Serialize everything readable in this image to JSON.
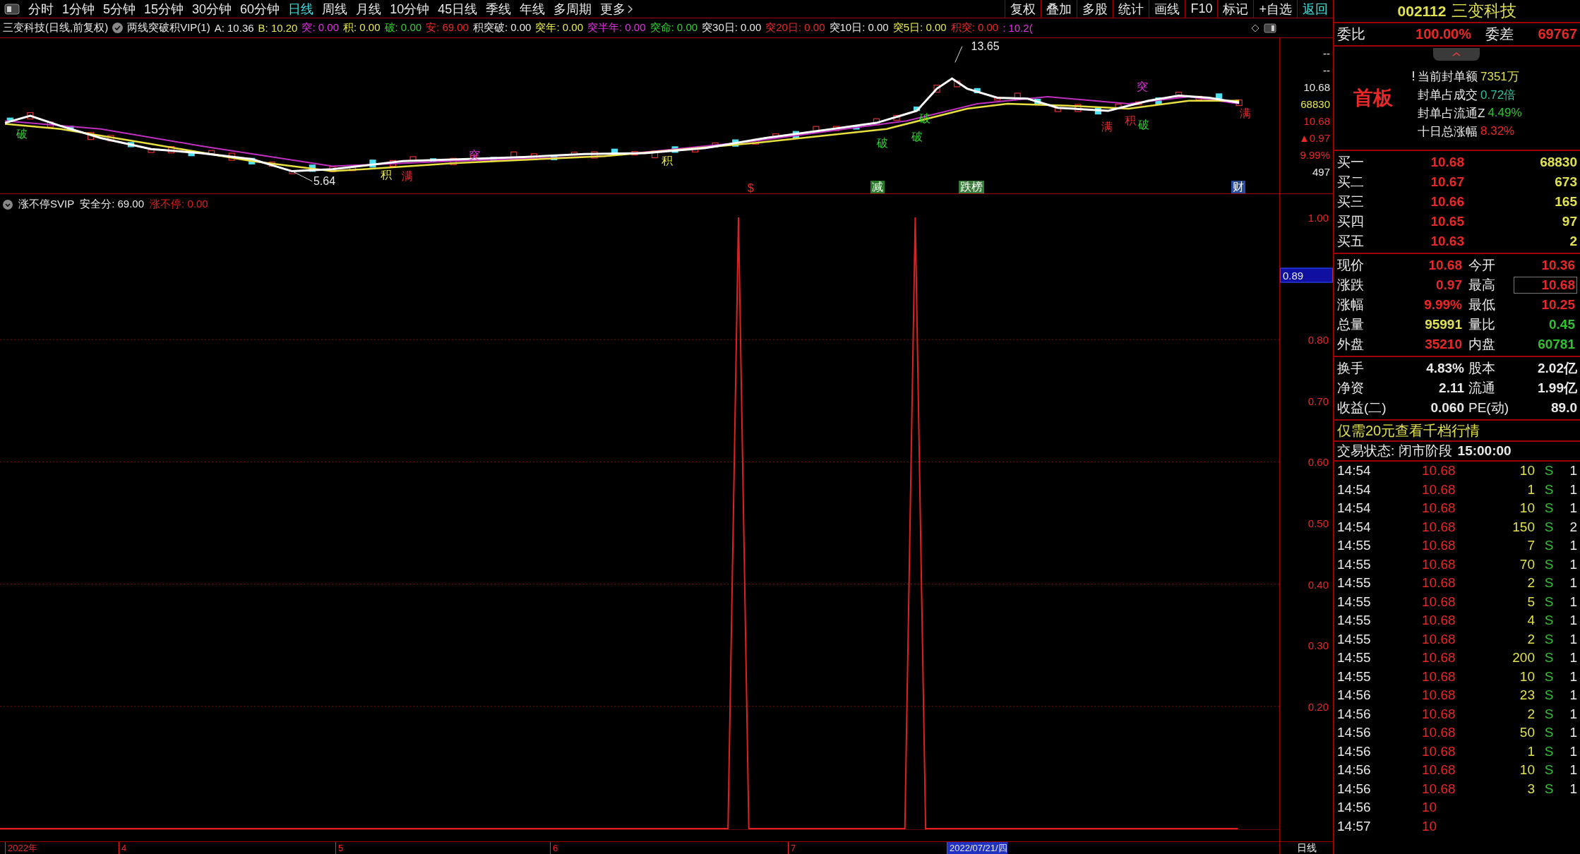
{
  "toolbar": {
    "periods": [
      {
        "label": "分时",
        "selected": false
      },
      {
        "label": "1分钟",
        "selected": false
      },
      {
        "label": "5分钟",
        "selected": false
      },
      {
        "label": "15分钟",
        "selected": false
      },
      {
        "label": "30分钟",
        "selected": false
      },
      {
        "label": "60分钟",
        "selected": false
      },
      {
        "label": "日线",
        "selected": true
      },
      {
        "label": "周线",
        "selected": false
      },
      {
        "label": "月线",
        "selected": false
      },
      {
        "label": "10分钟",
        "selected": false
      },
      {
        "label": "45日线",
        "selected": false
      },
      {
        "label": "季线",
        "selected": false
      },
      {
        "label": "年线",
        "selected": false
      },
      {
        "label": "多周期",
        "selected": false
      }
    ],
    "more": "更多",
    "actions": [
      {
        "label": "复权",
        "selected": false
      },
      {
        "label": "叠加",
        "selected": false
      },
      {
        "label": "多股",
        "selected": false
      },
      {
        "label": "统计",
        "selected": false
      },
      {
        "label": "画线",
        "selected": false
      },
      {
        "label": "F10",
        "selected": false
      },
      {
        "label": "标记",
        "selected": false
      },
      {
        "label": "+自选",
        "selected": false
      },
      {
        "label": "返回",
        "selected": true
      }
    ]
  },
  "chart_header": {
    "title": "三变科技(日线,前复权)",
    "indicator": "两线突破积VIP(1)",
    "items": [
      {
        "text": "A: 10.36",
        "color": "#e8e8e8"
      },
      {
        "text": "B: 10.20",
        "color": "#e8e850"
      },
      {
        "text": "突: 0.00",
        "color": "#e030e0"
      },
      {
        "text": "积: 0.00",
        "color": "#e8e850"
      },
      {
        "text": "破: 0.00",
        "color": "#30d030"
      },
      {
        "text": "安: 69.00",
        "color": "#e82828"
      },
      {
        "text": "积突破: 0.00",
        "color": "#e8e8e8"
      },
      {
        "text": "突年: 0.00",
        "color": "#e8e850"
      },
      {
        "text": "突半年: 0.00",
        "color": "#e030e0"
      },
      {
        "text": "突命: 0.00",
        "color": "#30d030"
      },
      {
        "text": "突30日: 0.00",
        "color": "#e8e8e8"
      },
      {
        "text": "突20日: 0.00",
        "color": "#e82828"
      },
      {
        "text": "突10日: 0.00",
        "color": "#e8e8e8"
      },
      {
        "text": "突5日: 0.00",
        "color": "#e8e850"
      },
      {
        "text": "积突: 0.00",
        "color": "#e82828"
      },
      {
        "text": ": 10.2(",
        "color": "#e030e0"
      }
    ]
  },
  "price_chart": {
    "markers": [
      {
        "label": "破",
        "kind": "signal",
        "color": "#30d030"
      },
      {
        "label": "5.64",
        "kind": "price",
        "color": "#e8e8e8"
      },
      {
        "label": "积",
        "kind": "signal",
        "color": "#e8e850"
      },
      {
        "label": "满",
        "kind": "signal",
        "color": "#e82828"
      },
      {
        "label": "突",
        "kind": "signal",
        "color": "#e030e0"
      },
      {
        "label": "积",
        "kind": "signal",
        "color": "#e8e850"
      },
      {
        "label": "破",
        "kind": "signal",
        "color": "#30d030"
      },
      {
        "label": "破",
        "kind": "signal",
        "color": "#30d030"
      },
      {
        "label": "破",
        "kind": "signal",
        "color": "#30d030"
      },
      {
        "label": "13.65",
        "kind": "price",
        "color": "#e8e8e8"
      },
      {
        "label": "突",
        "kind": "signal",
        "color": "#e030e0"
      },
      {
        "label": "满",
        "kind": "signal",
        "color": "#e82828"
      },
      {
        "label": "积",
        "kind": "signal",
        "color": "#e82828"
      },
      {
        "label": "破",
        "kind": "signal",
        "color": "#30d030"
      },
      {
        "label": "满",
        "kind": "signal",
        "color": "#e82828"
      },
      {
        "label": "$",
        "kind": "signal",
        "color": "#e82828"
      },
      {
        "label": "减",
        "kind": "tag",
        "color": "#2a7a2a"
      },
      {
        "label": "跌榜",
        "kind": "tag",
        "color": "#3a7a3a"
      },
      {
        "label": "财",
        "kind": "tag",
        "color": "#2a4a9a"
      }
    ],
    "axis_labels": [
      {
        "text": "--",
        "color": "#e8e8e8"
      },
      {
        "text": "--",
        "color": "#e8e8e8"
      },
      {
        "text": "10.68",
        "color": "#e8e8e8"
      },
      {
        "text": "68830",
        "color": "#e8e850"
      },
      {
        "text": "10.68",
        "color": "#e82828"
      },
      {
        "text": "▲0.97",
        "color": "#e82828"
      },
      {
        "text": "9.99%",
        "color": "#e82828"
      },
      {
        "text": "497",
        "color": "#e8e8e8"
      }
    ]
  },
  "indicator": {
    "title": "涨不停SVIP",
    "items": [
      {
        "text": "安全分: 69.00"
      }
    ],
    "legend_value": ": 0.00",
    "cursor_value": "0.89",
    "chart_data": {
      "type": "line",
      "grid": true,
      "ylim": [
        0,
        1
      ],
      "yticks": [
        {
          "value": 1,
          "label": "1.00"
        },
        {
          "value": 0.8,
          "label": "0.80"
        },
        {
          "value": 0.7,
          "label": "0.70"
        },
        {
          "value": 0.6,
          "label": "0.60"
        },
        {
          "value": 0.5,
          "label": "0.50"
        },
        {
          "value": 0.4,
          "label": "0.40"
        },
        {
          "value": 0.3,
          "label": "0.30"
        },
        {
          "value": 0.2,
          "label": "0.20"
        }
      ],
      "series": [
        {
          "name": "涨不停",
          "color": "#e02020",
          "values": [
            0,
            0,
            0,
            0,
            0,
            0,
            0,
            0,
            0,
            0,
            0,
            0,
            0,
            0,
            0,
            0,
            0,
            0,
            0,
            0,
            0,
            0,
            0,
            0,
            0,
            0,
            0,
            0,
            0,
            0,
            0,
            0,
            0,
            0,
            0,
            0,
            0,
            0,
            0,
            0,
            0,
            0,
            0,
            0,
            0,
            0,
            0,
            0,
            0,
            0,
            0,
            0,
            0,
            0,
            0,
            0,
            0,
            0,
            0,
            0,
            0,
            0,
            0,
            0,
            0,
            0,
            0,
            0,
            0,
            0,
            0,
            1,
            0,
            0,
            0,
            0,
            0,
            0,
            0,
            0,
            0,
            0,
            0,
            0,
            0,
            0,
            0,
            0,
            1,
            0,
            0,
            0,
            0,
            0,
            0,
            0,
            0,
            0,
            0,
            0,
            0,
            0,
            0,
            0,
            0,
            0,
            0,
            0,
            0,
            0,
            0,
            0,
            0,
            0,
            0,
            0,
            0,
            0,
            0,
            0,
            null,
            null,
            null,
            null
          ]
        }
      ]
    }
  },
  "date_axis": {
    "labels": [
      "2022年",
      "4",
      "5",
      "6",
      "7"
    ],
    "cursor_date": "2022/07/21/四",
    "period": "日线"
  },
  "quote_panel": {
    "code": "002112",
    "name": "三变科技",
    "ratio": {
      "label": "委比",
      "value": "100.00%",
      "label2": "委差",
      "value2": "69767"
    },
    "board": "首板",
    "seal_info": [
      {
        "label": "当前封单额",
        "value": "7351万",
        "color": "#e0e050"
      },
      {
        "label": "封单占成交",
        "value": "0.72倍",
        "color": "#30c0a0"
      },
      {
        "label": "封单占流通Z",
        "value": "4.49%",
        "color": "#30c030"
      },
      {
        "label": "十日总涨幅",
        "value": "8.32%",
        "color": "#e82828"
      }
    ],
    "bids": [
      {
        "label": "买一",
        "price": "10.68",
        "volume": "68830"
      },
      {
        "label": "买二",
        "price": "10.67",
        "volume": "673"
      },
      {
        "label": "买三",
        "price": "10.66",
        "volume": "165"
      },
      {
        "label": "买四",
        "price": "10.65",
        "volume": "97"
      },
      {
        "label": "买五",
        "price": "10.63",
        "volume": "2"
      }
    ],
    "quotes": [
      {
        "cells": [
          {
            "label": "现价",
            "value": "10.68",
            "color": "#e82828",
            "highlighted": false
          },
          {
            "label": "今开",
            "value": "10.36",
            "color": "#e82828",
            "highlighted": false
          }
        ]
      },
      {
        "cells": [
          {
            "label": "涨跌",
            "value": "0.97",
            "color": "#e82828",
            "highlighted": false
          },
          {
            "label": "最高",
            "value": "10.68",
            "color": "#e82828",
            "highlighted": true
          }
        ]
      },
      {
        "cells": [
          {
            "label": "涨幅",
            "value": "9.99%",
            "color": "#e82828",
            "highlighted": false
          },
          {
            "label": "最低",
            "value": "10.25",
            "color": "#e82828",
            "highlighted": false
          }
        ]
      },
      {
        "cells": [
          {
            "label": "总量",
            "value": "95991",
            "color": "#e0e050",
            "highlighted": false
          },
          {
            "label": "量比",
            "value": "0.45",
            "color": "#30c030",
            "highlighted": false
          }
        ]
      },
      {
        "cells": [
          {
            "label": "外盘",
            "value": "35210",
            "color": "#e82828",
            "highlighted": false
          },
          {
            "label": "内盘",
            "value": "60781",
            "color": "#30c030",
            "highlighted": false
          }
        ]
      }
    ],
    "stats": [
      {
        "label": "换手",
        "value": "4.83%",
        "label2": "股本",
        "value2": "2.02亿"
      },
      {
        "label": "净资",
        "value": "2.11",
        "label2": "流通",
        "value2": "1.99亿"
      },
      {
        "label": "收益(二)",
        "value": "0.060",
        "label2": "PE(动)",
        "value2": "89.0"
      }
    ],
    "promo": "仅需20元查看千档行情",
    "status": {
      "label": "交易状态: 闭市阶段",
      "time": "15:00:00"
    },
    "trades": [
      {
        "time": "14:54",
        "price": "10.68",
        "volume": "10",
        "side": "S",
        "extra": "1"
      },
      {
        "time": "14:54",
        "price": "10.68",
        "volume": "1",
        "side": "S",
        "extra": "1"
      },
      {
        "time": "14:54",
        "price": "10.68",
        "volume": "10",
        "side": "S",
        "extra": "1"
      },
      {
        "time": "14:54",
        "price": "10.68",
        "volume": "150",
        "side": "S",
        "extra": "2"
      },
      {
        "time": "14:55",
        "price": "10.68",
        "volume": "7",
        "side": "S",
        "extra": "1"
      },
      {
        "time": "14:55",
        "price": "10.68",
        "volume": "70",
        "side": "S",
        "extra": "1"
      },
      {
        "time": "14:55",
        "price": "10.68",
        "volume": "2",
        "side": "S",
        "extra": "1"
      },
      {
        "time": "14:55",
        "price": "10.68",
        "volume": "5",
        "side": "S",
        "extra": "1"
      },
      {
        "time": "14:55",
        "price": "10.68",
        "volume": "4",
        "side": "S",
        "extra": "1"
      },
      {
        "time": "14:55",
        "price": "10.68",
        "volume": "2",
        "side": "S",
        "extra": "1"
      },
      {
        "time": "14:55",
        "price": "10.68",
        "volume": "200",
        "side": "S",
        "extra": "1"
      },
      {
        "time": "14:55",
        "price": "10.68",
        "volume": "10",
        "side": "S",
        "extra": "1"
      },
      {
        "time": "14:56",
        "price": "10.68",
        "volume": "23",
        "side": "S",
        "extra": "1"
      },
      {
        "time": "14:56",
        "price": "10.68",
        "volume": "2",
        "side": "S",
        "extra": "1"
      },
      {
        "time": "14:56",
        "price": "10.68",
        "volume": "50",
        "side": "S",
        "extra": "1"
      },
      {
        "time": "14:56",
        "price": "10.68",
        "volume": "1",
        "side": "S",
        "extra": "1"
      },
      {
        "time": "14:56",
        "price": "10.68",
        "volume": "10",
        "side": "S",
        "extra": "1"
      },
      {
        "time": "14:56",
        "price": "10.68",
        "volume": "3",
        "side": "S",
        "extra": "1"
      },
      {
        "time": "14:56",
        "price": "10"
      },
      {
        "time": "14:57",
        "price": "10"
      }
    ]
  }
}
